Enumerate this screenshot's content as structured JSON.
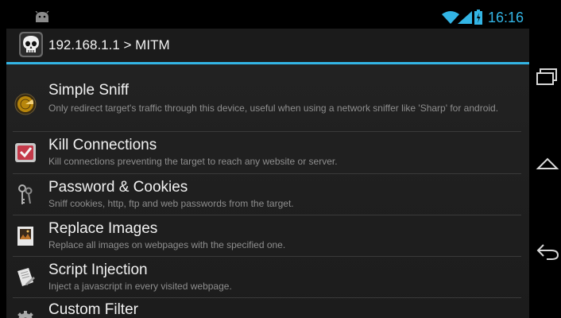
{
  "status_bar": {
    "time": "16:16",
    "icons": [
      "android-icon",
      "wifi-icon",
      "signal-icon",
      "battery-icon"
    ]
  },
  "action_bar": {
    "title": "192.168.1.1 > MITM",
    "icon": "skull-icon"
  },
  "items": [
    {
      "title": "Simple Sniff",
      "description": "Only redirect target's traffic through this device, useful when using a network sniffer like 'Sharp' for android.",
      "icon": "radar-icon"
    },
    {
      "title": "Kill Connections",
      "description": "Kill connections preventing the target to reach any website or server.",
      "icon": "kill-icon"
    },
    {
      "title": "Password & Cookies",
      "description": "Sniff cookies, http, ftp and web passwords from the target.",
      "icon": "keys-icon"
    },
    {
      "title": "Replace Images",
      "description": "Replace all images on webpages with the specified one.",
      "icon": "image-icon"
    },
    {
      "title": "Script Injection",
      "description": "Inject a javascript in every visited webpage.",
      "icon": "script-icon"
    },
    {
      "title": "Custom Filter",
      "description": "",
      "icon": "gears-icon"
    }
  ],
  "nav_bar": {
    "buttons": [
      "recent-apps-icon",
      "home-icon",
      "back-icon"
    ]
  },
  "colors": {
    "accent": "#33b5e5",
    "background": "#000000",
    "list_background": "#1e1e1e"
  }
}
